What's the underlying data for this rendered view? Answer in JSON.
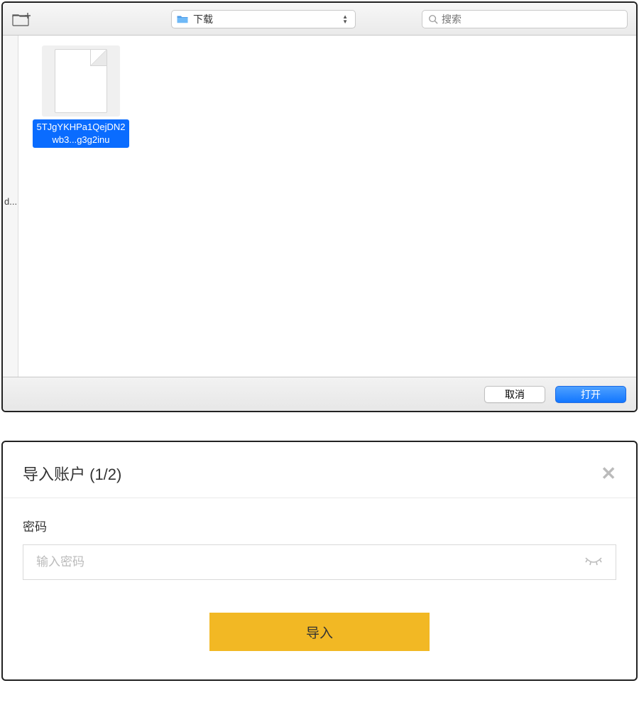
{
  "file_dialog": {
    "folder_name": "下载",
    "search_placeholder": "搜索",
    "sidebar_truncated": "d...",
    "selected_file": "5TJgYKHPa1QejDN2wb3...g3g2inu",
    "cancel_label": "取消",
    "open_label": "打开"
  },
  "import_modal": {
    "title": "导入账户 (1/2)",
    "password_label": "密码",
    "password_placeholder": "输入密码",
    "import_label": "导入"
  }
}
